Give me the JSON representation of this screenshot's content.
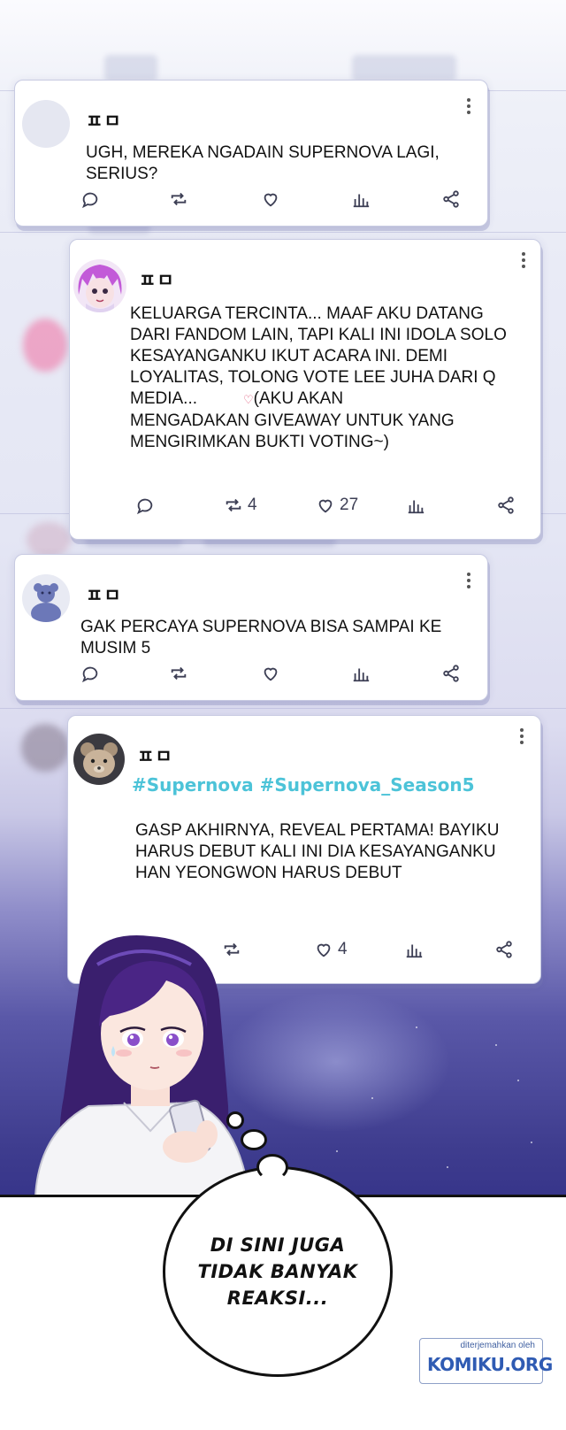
{
  "posts": [
    {
      "username": "ㅍㅁ",
      "avatar": "blank-avatar",
      "text": "UGH, MEREKA NGADAIN SUPERNOVA LAGI,\nSERIUS?",
      "hashtags": "",
      "stats": {
        "replies": "",
        "reposts": "",
        "likes": ""
      }
    },
    {
      "username": "ㅍㅁ",
      "avatar": "pink-hair-girl-avatar",
      "text": "KELUARGA TERCINTA... MAAF AKU DATANG\nDARI FANDOM LAIN, TAPI KALI INI IDOLA SOLO\nKESAYANGANKU IKUT ACARA INI. DEMI\nLOYALITAS, TOLONG VOTE LEE JUHA DARI Q\nMEDIA...",
      "text_tail": "(AKU AKAN\nMENGADAKAN GIVEAWAY UNTUK YANG\nMENGIRIMKAN BUKTI VOTING~)",
      "hashtags": "",
      "stats": {
        "replies": "",
        "reposts": "4",
        "likes": "27"
      }
    },
    {
      "username": "ㅍㅁ",
      "avatar": "bear-avatar",
      "text": "GAK PERCAYA SUPERNOVA BISA SAMPAI KE\nMUSIM 5",
      "hashtags": "",
      "stats": {
        "replies": "",
        "reposts": "",
        "likes": ""
      }
    },
    {
      "username": "ㅍㅁ",
      "avatar": "teddy-bear-photo-avatar",
      "text": "GASP AKHIRNYA, REVEAL PERTAMA! BAYIKU\nHARUS DEBUT KALI INI DIA KESAYANGANKU\nHAN YEONGWON HARUS DEBUT",
      "hashtags": "#Supernova #Supernova_Season5",
      "stats": {
        "replies": "",
        "reposts": "",
        "likes": "4"
      }
    }
  ],
  "inline_heart": "♡",
  "bubble": {
    "text": "DI SINI JUGA\nTIDAK BANYAK\nREAKSI..."
  },
  "watermark": {
    "small": "diterjemahkan oleh",
    "brand": "KOMIKU.ORG"
  },
  "colors": {
    "hashtag": "#4cc3d8",
    "card_border": "#c8cbe2",
    "night_sky": "#3e3c8e",
    "watermark_blue": "#2f5bb3"
  }
}
